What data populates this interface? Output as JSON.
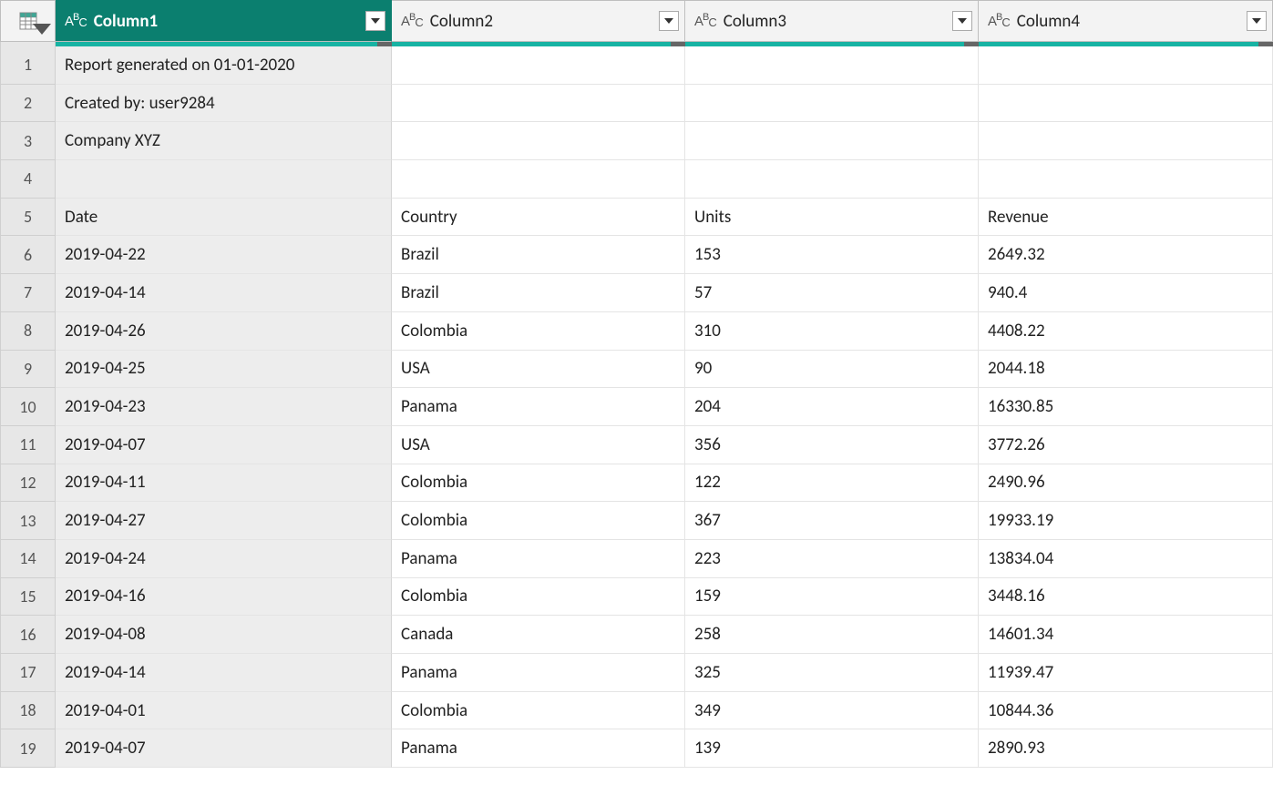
{
  "columns": [
    {
      "name": "Column1",
      "selected": true,
      "width": "w1"
    },
    {
      "name": "Column2",
      "selected": false,
      "width": "w2"
    },
    {
      "name": "Column3",
      "selected": false,
      "width": "w3"
    },
    {
      "name": "Column4",
      "selected": false,
      "width": "w4"
    }
  ],
  "type_icon_label": "ABC",
  "rows": [
    {
      "n": 1,
      "c1": "Report generated on 01-01-2020",
      "c2": "",
      "c3": "",
      "c4": ""
    },
    {
      "n": 2,
      "c1": "Created by: user9284",
      "c2": "",
      "c3": "",
      "c4": ""
    },
    {
      "n": 3,
      "c1": "Company XYZ",
      "c2": "",
      "c3": "",
      "c4": ""
    },
    {
      "n": 4,
      "c1": "",
      "c2": "",
      "c3": "",
      "c4": ""
    },
    {
      "n": 5,
      "c1": "Date",
      "c2": "Country",
      "c3": "Units",
      "c4": "Revenue"
    },
    {
      "n": 6,
      "c1": "2019-04-22",
      "c2": "Brazil",
      "c3": "153",
      "c4": "2649.32"
    },
    {
      "n": 7,
      "c1": "2019-04-14",
      "c2": "Brazil",
      "c3": "57",
      "c4": "940.4"
    },
    {
      "n": 8,
      "c1": "2019-04-26",
      "c2": "Colombia",
      "c3": "310",
      "c4": "4408.22"
    },
    {
      "n": 9,
      "c1": "2019-04-25",
      "c2": "USA",
      "c3": "90",
      "c4": "2044.18"
    },
    {
      "n": 10,
      "c1": "2019-04-23",
      "c2": "Panama",
      "c3": "204",
      "c4": "16330.85"
    },
    {
      "n": 11,
      "c1": "2019-04-07",
      "c2": "USA",
      "c3": "356",
      "c4": "3772.26"
    },
    {
      "n": 12,
      "c1": "2019-04-11",
      "c2": "Colombia",
      "c3": "122",
      "c4": "2490.96"
    },
    {
      "n": 13,
      "c1": "2019-04-27",
      "c2": "Colombia",
      "c3": "367",
      "c4": "19933.19"
    },
    {
      "n": 14,
      "c1": "2019-04-24",
      "c2": "Panama",
      "c3": "223",
      "c4": "13834.04"
    },
    {
      "n": 15,
      "c1": "2019-04-16",
      "c2": "Colombia",
      "c3": "159",
      "c4": "3448.16"
    },
    {
      "n": 16,
      "c1": "2019-04-08",
      "c2": "Canada",
      "c3": "258",
      "c4": "14601.34"
    },
    {
      "n": 17,
      "c1": "2019-04-14",
      "c2": "Panama",
      "c3": "325",
      "c4": "11939.47"
    },
    {
      "n": 18,
      "c1": "2019-04-01",
      "c2": "Colombia",
      "c3": "349",
      "c4": "10844.36"
    },
    {
      "n": 19,
      "c1": "2019-04-07",
      "c2": "Panama",
      "c3": "139",
      "c4": "2890.93"
    }
  ],
  "accent_color": "#17b3a3",
  "accent_dark": "#666"
}
